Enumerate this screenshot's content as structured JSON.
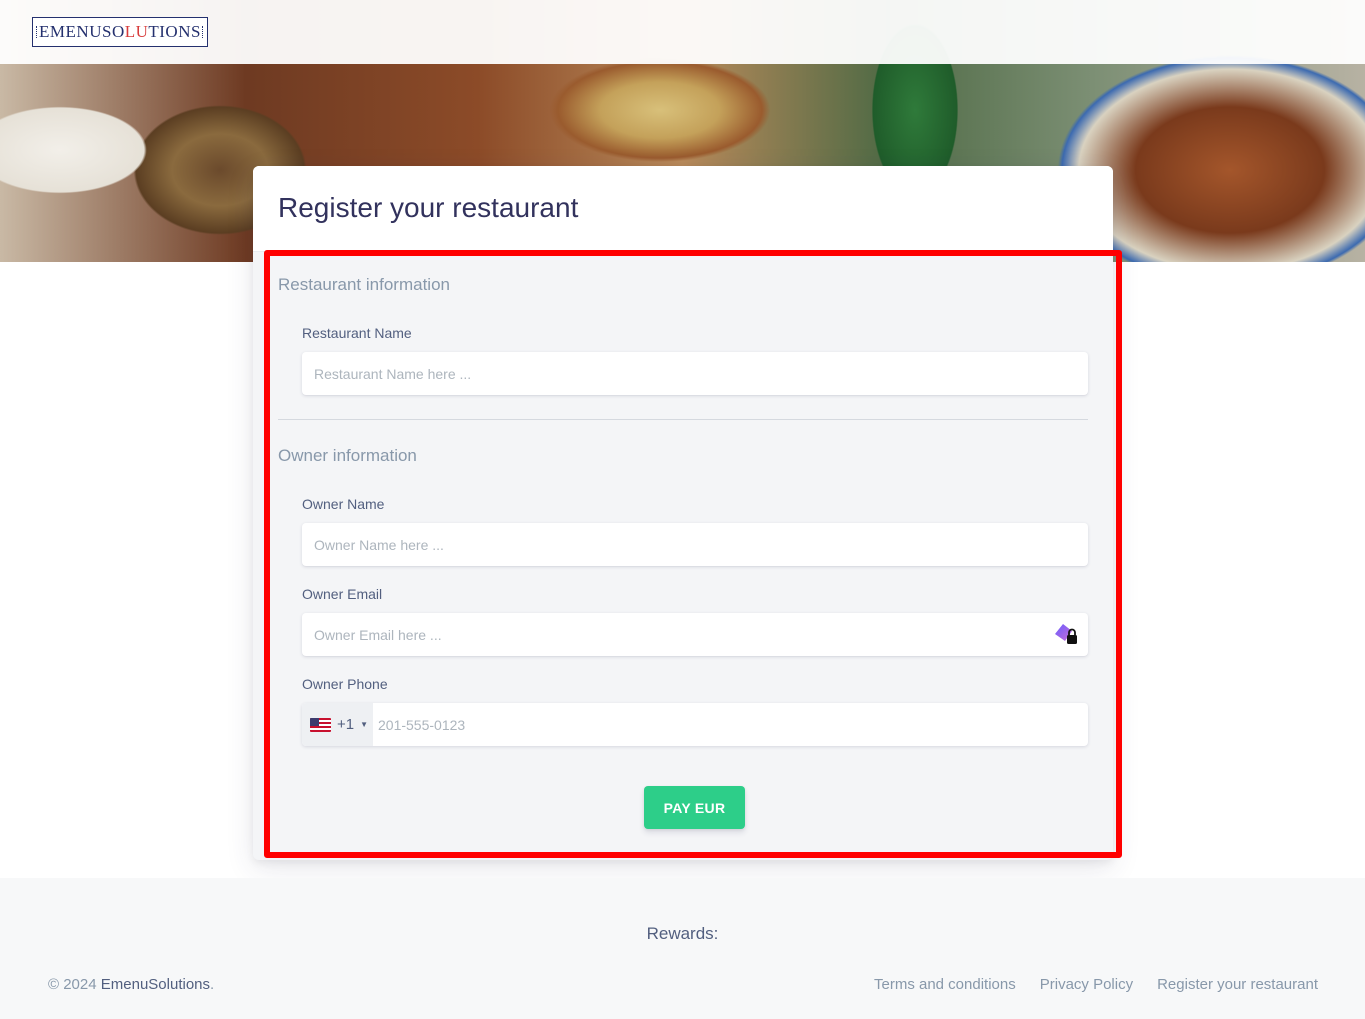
{
  "header": {
    "logo": {
      "part1": "EMENUSO",
      "accent": "LU",
      "part2": "TIONS"
    }
  },
  "form": {
    "title": "Register your restaurant",
    "restaurant_section": {
      "heading": "Restaurant information",
      "name_label": "Restaurant Name",
      "name_placeholder": "Restaurant Name here ..."
    },
    "owner_section": {
      "heading": "Owner information",
      "name_label": "Owner Name",
      "name_placeholder": "Owner Name here ...",
      "email_label": "Owner Email",
      "email_placeholder": "Owner Email here ...",
      "phone_label": "Owner Phone",
      "phone_country": "US",
      "phone_dial_code": "+1",
      "phone_placeholder": "201-555-0123"
    },
    "submit_label": "PAY EUR",
    "submit_color": "#2dce89"
  },
  "highlight_color": "#ff0000",
  "footer": {
    "rewards_label": "Rewards:",
    "copyright_prefix": "© 2024 ",
    "brand": "EmenuSolutions",
    "copyright_suffix": ".",
    "links": [
      "Terms and conditions",
      "Privacy Policy",
      "Register your restaurant"
    ]
  }
}
